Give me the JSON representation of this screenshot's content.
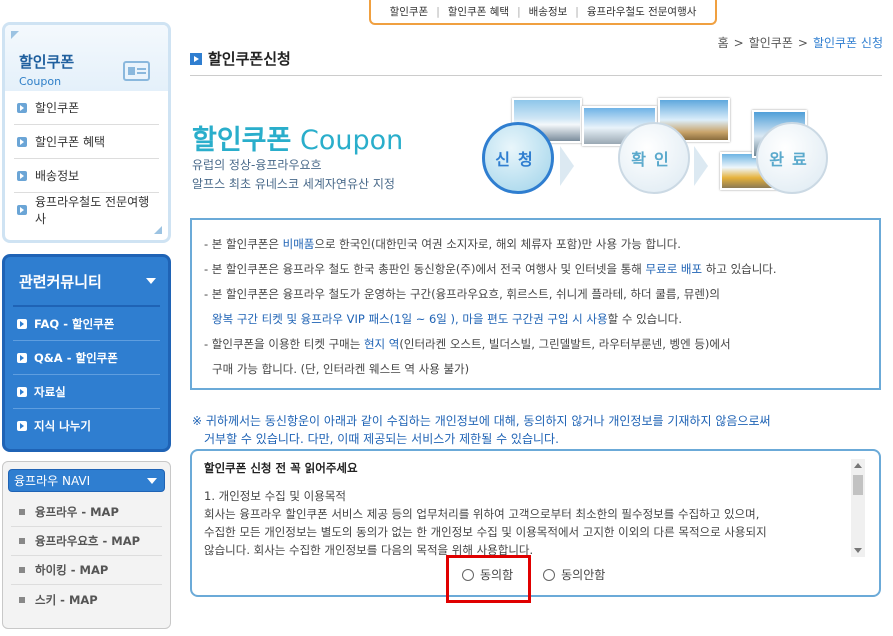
{
  "topnav": {
    "items": [
      "할인쿠폰",
      "할인쿠폰 혜택",
      "배송정보",
      "융프라우철도 전문여행사"
    ]
  },
  "coupon_menu": {
    "title": "할인쿠폰",
    "subtitle": "Coupon",
    "items": [
      "할인쿠폰",
      "할인쿠폰 혜택",
      "배송정보",
      "융프라우철도 전문여행사"
    ]
  },
  "community": {
    "title": "관련커뮤니티",
    "items": [
      "FAQ - 할인쿠폰",
      "Q&A - 할인쿠폰",
      "자료실",
      "지식 나누기"
    ]
  },
  "navi": {
    "selected": "융프라우 NAVI",
    "items": [
      "융프라우 - MAP",
      "융프라우요흐 - MAP",
      "하이킹 - MAP",
      "스키 - MAP"
    ]
  },
  "breadcrumb": {
    "home": "홈",
    "parent": "할인쿠폰",
    "current": "할인쿠폰 신청"
  },
  "page_title": "할인쿠폰신청",
  "hero": {
    "title_ko": "할인쿠폰",
    "title_en": "Coupon",
    "desc1": "유럽의 정상-융프라우요흐",
    "desc2": "알프스 최초 유네스코 세계자연유산 지정",
    "steps": [
      "신청",
      "확인",
      "완료"
    ]
  },
  "info": {
    "l1a": "- 본 할인쿠폰은 ",
    "l1b": "비매품",
    "l1c": "으로 한국인(대한민국 여권 소지자로, 해외 체류자 포함)만 사용 가능 합니다.",
    "l2a": "- 본 할인쿠폰은 융프라우 철도 한국 총판인 동신항운(주)에서 전국 여행사 및 인터넷을 통해 ",
    "l2b": "무료로 배포",
    "l2c": " 하고 있습니다.",
    "l3": "- 본 할인쿠폰은 융프라우 철도가 운영하는 구간(융프라우요흐, 휘르스트, 쉬니게 플라테, 하더 쿨름, 뮤렌)의",
    "l4a": "왕복 구간 티켓 및 융프라우 VIP 패스(1일 ~ 6일 ), 마을 편도 구간권 구입 시 사용",
    "l4b": "할 수 있습니다.",
    "l5a": "- 할인쿠폰을 이용한 티켓 구매는 ",
    "l5b": "현지 역",
    "l5c": "(인터라켄 오스트, 빌더스빌, 그린델발트, 라우터부룬넨, 벵엔 등)에서",
    "l6": "구매 가능 합니다. (단, 인터라켄 웨스트 역 사용 불가)"
  },
  "notice": {
    "line1": "※ 귀하께서는 동신항운이 아래과 같이 수집하는 개인정보에 대해, 동의하지 않거나 개인정보를 기재하지 않음으로써",
    "line2": "거부할 수 있습니다. 다만, 이때 제공되는 서비스가 제한될 수 있습니다."
  },
  "consent": {
    "heading": "할인쿠폰 신청 전 꼭 읽어주세요",
    "s1": "1. 개인정보 수집 및 이용목적",
    "p1": "회사는 융프라우 할인쿠폰 서비스 제공 등의 업무처리를 위하여 고객으로부터 최소한의 필수정보를 수집하고 있으며,",
    "p2": "수집한 모든 개인정보는 별도의 동의가 없는 한 개인정보 수집 및 이용목적에서 고지한 이외의 다른 목적으로 사용되지",
    "p3": "않습니다. 회사는 수집한 개인정보를 다음의 목적을 위해 사용합니다.",
    "agree": "동의함",
    "disagree": "동의안함"
  },
  "colors": {
    "accent": "#2f7ed0",
    "highlight_box": "#e00000"
  }
}
